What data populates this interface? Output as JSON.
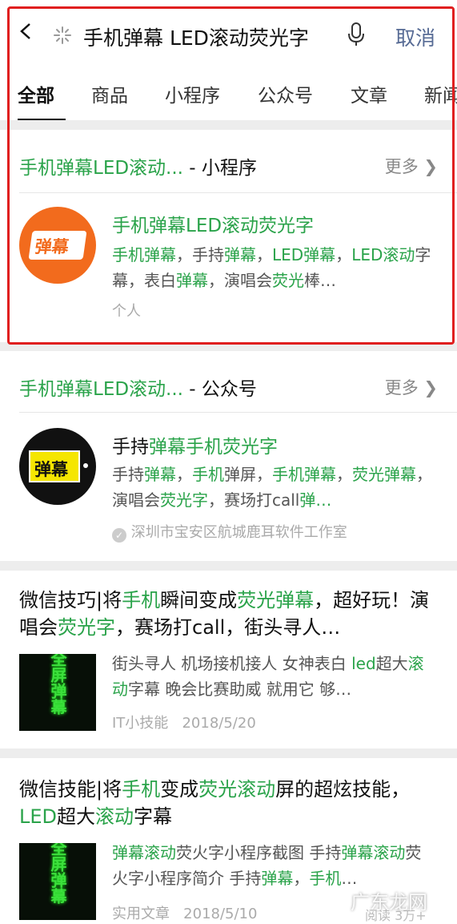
{
  "search": {
    "query": "手机弹幕 LED滚动荧光字",
    "cancel_label": "取消"
  },
  "tabs": [
    "全部",
    "商品",
    "小程序",
    "公众号",
    "文章",
    "新闻"
  ],
  "miniprogram_section": {
    "header_name": "手机弹幕LED滚动...",
    "header_type": " - 小程序",
    "more_label": "更多",
    "item": {
      "title": "手机弹幕LED滚动荧光字",
      "logo_text": "弹幕",
      "desc_parts": [
        {
          "t": "手机弹幕",
          "hl": true
        },
        {
          "t": "，手持",
          "hl": false
        },
        {
          "t": "弹幕",
          "hl": true
        },
        {
          "t": "，",
          "hl": false
        },
        {
          "t": "LED弹幕",
          "hl": true
        },
        {
          "t": "，",
          "hl": false
        },
        {
          "t": "LED滚动",
          "hl": true
        },
        {
          "t": "字幕，表白",
          "hl": false
        },
        {
          "t": "弹幕",
          "hl": true
        },
        {
          "t": "，演唱会",
          "hl": false
        },
        {
          "t": "荧光",
          "hl": true
        },
        {
          "t": "棒…",
          "hl": false
        }
      ],
      "meta": "个人"
    }
  },
  "official_section": {
    "header_name": "手机弹幕LED滚动...",
    "header_type": " - 公众号",
    "more_label": "更多",
    "item": {
      "title_parts": [
        {
          "t": "手持",
          "hl": false
        },
        {
          "t": "弹幕手机荧光字",
          "hl": true
        }
      ],
      "logo_text": "弹幕",
      "desc_parts": [
        {
          "t": "手持",
          "hl": false
        },
        {
          "t": "弹幕",
          "hl": true
        },
        {
          "t": "，",
          "hl": false
        },
        {
          "t": "手机",
          "hl": true
        },
        {
          "t": "弹屏，",
          "hl": false
        },
        {
          "t": "手机弹幕",
          "hl": true
        },
        {
          "t": "，",
          "hl": false
        },
        {
          "t": "荧光弹幕",
          "hl": true
        },
        {
          "t": "，演唱会",
          "hl": false
        },
        {
          "t": "荧光字",
          "hl": true
        },
        {
          "t": "，赛场打call",
          "hl": false
        },
        {
          "t": "弹…",
          "hl": true
        }
      ],
      "meta": "深圳市宝安区航城鹿耳软件工作室"
    }
  },
  "articles": [
    {
      "title_parts": [
        {
          "t": "微信技巧|将",
          "hl": false
        },
        {
          "t": "手机",
          "hl": true
        },
        {
          "t": "瞬间变成",
          "hl": false
        },
        {
          "t": "荧光弹幕",
          "hl": true
        },
        {
          "t": "，超好玩！演唱会",
          "hl": false
        },
        {
          "t": "荧光字",
          "hl": true
        },
        {
          "t": "，赛场打call，街头寻人…",
          "hl": false
        }
      ],
      "thumb_text": "全屏弹幕",
      "desc_parts": [
        {
          "t": "街头寻人 机场接机接人 女神表白 ",
          "hl": false
        },
        {
          "t": "led",
          "hl": true
        },
        {
          "t": "超大",
          "hl": false
        },
        {
          "t": "滚动",
          "hl": true
        },
        {
          "t": "字幕 晚会比赛助威 就用它 够…",
          "hl": false
        }
      ],
      "source": "IT小技能",
      "date": "2018/5/20"
    },
    {
      "title_parts": [
        {
          "t": "微信技能|将",
          "hl": false
        },
        {
          "t": "手机",
          "hl": true
        },
        {
          "t": "变成",
          "hl": false
        },
        {
          "t": "荧光滚动",
          "hl": true
        },
        {
          "t": "屏的超炫技能，",
          "hl": false
        },
        {
          "t": "LED",
          "hl": true
        },
        {
          "t": "超大",
          "hl": false
        },
        {
          "t": "滚动",
          "hl": true
        },
        {
          "t": "字幕",
          "hl": false
        }
      ],
      "thumb_text": "全屏弹幕",
      "desc_parts": [
        {
          "t": "弹幕滚动",
          "hl": true
        },
        {
          "t": "荧火字小程序截图 手持",
          "hl": false
        },
        {
          "t": "弹幕滚动",
          "hl": true
        },
        {
          "t": "荧火字小程序简介 手持",
          "hl": false
        },
        {
          "t": "弹幕",
          "hl": true
        },
        {
          "t": "，",
          "hl": false
        },
        {
          "t": "手机",
          "hl": true
        },
        {
          "t": "…",
          "hl": false
        }
      ],
      "source": "实用文章",
      "date": "2018/5/10",
      "read_count": "阅读 3万+"
    }
  ],
  "watermark": "广东龙网",
  "colors": {
    "highlight": "#2aa34a",
    "link_blue": "#576b95",
    "annotation_red": "#e01f1f",
    "miniprogram_logo": "#f26b1d"
  }
}
